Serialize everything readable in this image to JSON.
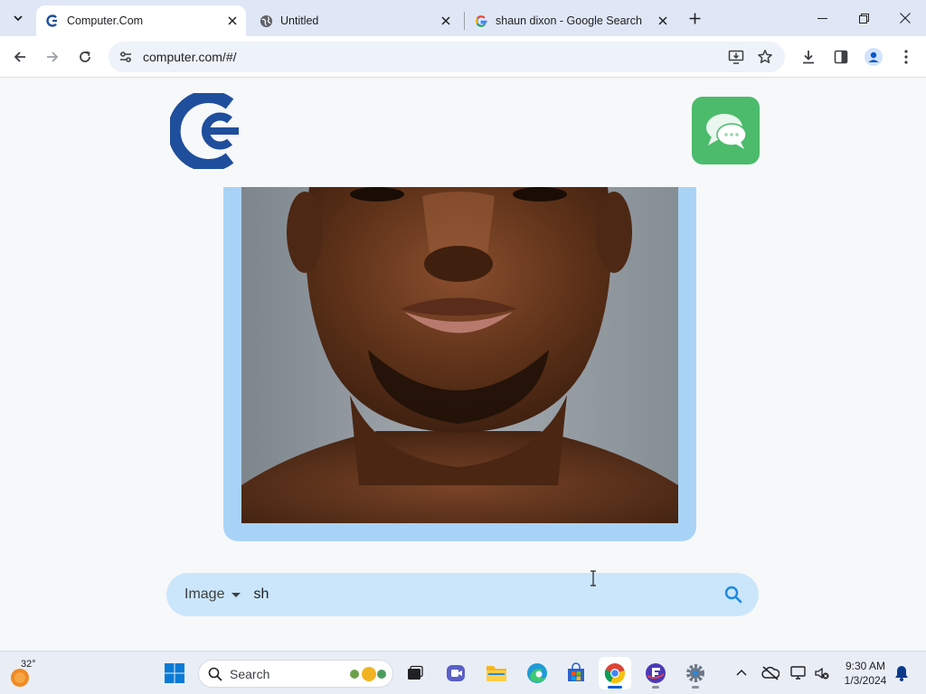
{
  "browser": {
    "tabs": [
      {
        "title": "Computer.Com",
        "active": true,
        "favicon": "computer-com-logo"
      },
      {
        "title": "Untitled",
        "active": false,
        "favicon": "globe-icon"
      },
      {
        "title": "shaun dixon - Google Search",
        "active": false,
        "favicon": "google-g-icon"
      }
    ],
    "url": "computer.com/#/"
  },
  "page": {
    "search": {
      "type_label": "Image",
      "query": "sh"
    }
  },
  "taskbar": {
    "weather_temp": "32°",
    "search_label": "Search",
    "time": "9:30 AM",
    "date": "1/3/2024",
    "apps": [
      "windows-start",
      "search",
      "task-view",
      "video-call",
      "file-explorer",
      "edge",
      "microsoft-store",
      "chrome",
      "app-f",
      "settings"
    ]
  },
  "colors": {
    "tab_strip": "#dfe7f6",
    "photo_frame": "#a9d3f6",
    "search_bar": "#cbe6fa",
    "logo_blue": "#1f4e9c",
    "chat_green": "#4cbb6c"
  }
}
